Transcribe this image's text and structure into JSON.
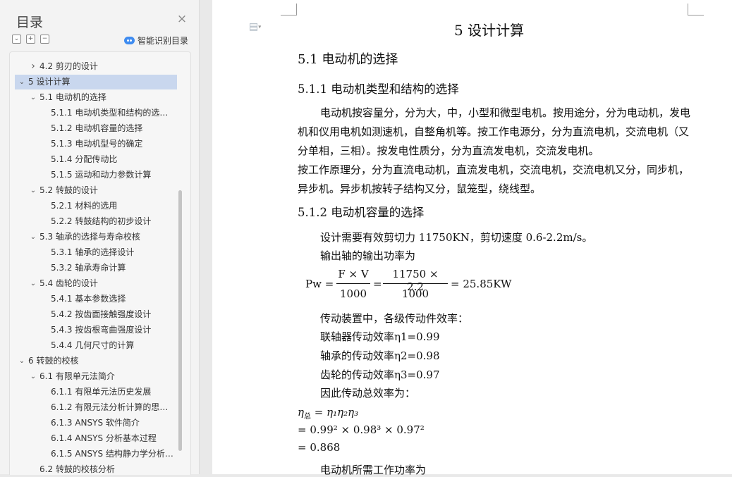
{
  "toc": {
    "title": "目录",
    "close_icon": "×",
    "smart_label": "智能识别目录",
    "items": [
      {
        "label": "4.2 剪刃的设计",
        "level": 1,
        "toggle": "right"
      },
      {
        "label": "5 设计计算",
        "level": 0,
        "toggle": "down",
        "active": true
      },
      {
        "label": "5.1 电动机的选择",
        "level": 1,
        "toggle": "down"
      },
      {
        "label": "5.1.1 电动机类型和结构的选…",
        "level": 2
      },
      {
        "label": "5.1.2 电动机容量的选择",
        "level": 2
      },
      {
        "label": "5.1.3 电动机型号的确定",
        "level": 2
      },
      {
        "label": "5.1.4 分配传动比",
        "level": 2
      },
      {
        "label": "5.1.5 运动和动力参数计算",
        "level": 2
      },
      {
        "label": "5.2 转鼓的设计",
        "level": 1,
        "toggle": "down"
      },
      {
        "label": "5.2.1 材料的选用",
        "level": 2
      },
      {
        "label": "5.2.2 转鼓结构的初步设计",
        "level": 2
      },
      {
        "label": "5.3 轴承的选择与寿命校核",
        "level": 1,
        "toggle": "down"
      },
      {
        "label": "5.3.1 轴承的选择设计",
        "level": 2
      },
      {
        "label": "5.3.2 轴承寿命计算",
        "level": 2
      },
      {
        "label": "5.4 齿轮的设计",
        "level": 1,
        "toggle": "down"
      },
      {
        "label": "5.4.1 基本参数选择",
        "level": 2
      },
      {
        "label": "5.4.2 按齿面接触强度设计",
        "level": 2
      },
      {
        "label": "5.4.3 按齿根弯曲强度设计",
        "level": 2
      },
      {
        "label": "5.4.4 几何尺寸的计算",
        "level": 2
      },
      {
        "label": "6 转鼓的校核",
        "level": 0,
        "toggle": "down"
      },
      {
        "label": "6.1 有限单元法简介",
        "level": 1,
        "toggle": "down"
      },
      {
        "label": "6.1.1 有限单元法历史发展",
        "level": 2
      },
      {
        "label": "6.1.2 有限元法分析计算的思…",
        "level": 2
      },
      {
        "label": "6.1.3 ANSYS 软件简介",
        "level": 2
      },
      {
        "label": "6.1.4 ANSYS 分析基本过程",
        "level": 2
      },
      {
        "label": "6.1.5 ANSYS 结构静力学分析…",
        "level": 2
      },
      {
        "label": "6.2 转鼓的校核分析",
        "level": 1
      }
    ]
  },
  "doc": {
    "chapter_title": "5  设计计算",
    "section_title": "5.1 电动机的选择",
    "sub1_title": "5.1.1 电动机类型和结构的选择",
    "para1": "电动机按容量分，分为大，中，小型和微型电机。按用途分，分为电动机，发电机和仪用电机如测速机，自整角机等。按工作电源分，分为直流电机，交流电机（又分单相，三相）。按发电性质分，分为直流发电机，交流发电机。",
    "para2": "按工作原理分，分为直流电动机，直流发电机，交流电机，交流电机又分，同步机，异步机。异步机按转子结构又分，鼠笼型，绕线型。",
    "sub2_title": "5.1.2  电动机容量的选择",
    "l1": "设计需要有效剪切力 11750KN，剪切速度 0.6-2.2m/s。",
    "l2": "输出轴的输出功率为",
    "f_lhs": "Pw =",
    "f_num1": "F × V",
    "f_den1": "1000",
    "f_eq": "=",
    "f_num2": "11750 × 2.2",
    "f_den2": "1000",
    "f_res": "= 25.85KW",
    "l3": "传动装置中，各级传动件效率：",
    "l4": "联轴器传动效率η1=0.99",
    "l5": "轴承的传动效率η2=0.98",
    "l6": "齿轮的传动效率η3=0.97",
    "l7": "因此传动总效率为：",
    "e1_lhs": "η",
    "e1_sub": "总",
    "e1_rhs": " = η₁η₂η₃",
    "e2": "= 0.99² × 0.98³ × 0.97²",
    "e3": "= 0.868",
    "l8": "电动机所需工作功率为"
  }
}
